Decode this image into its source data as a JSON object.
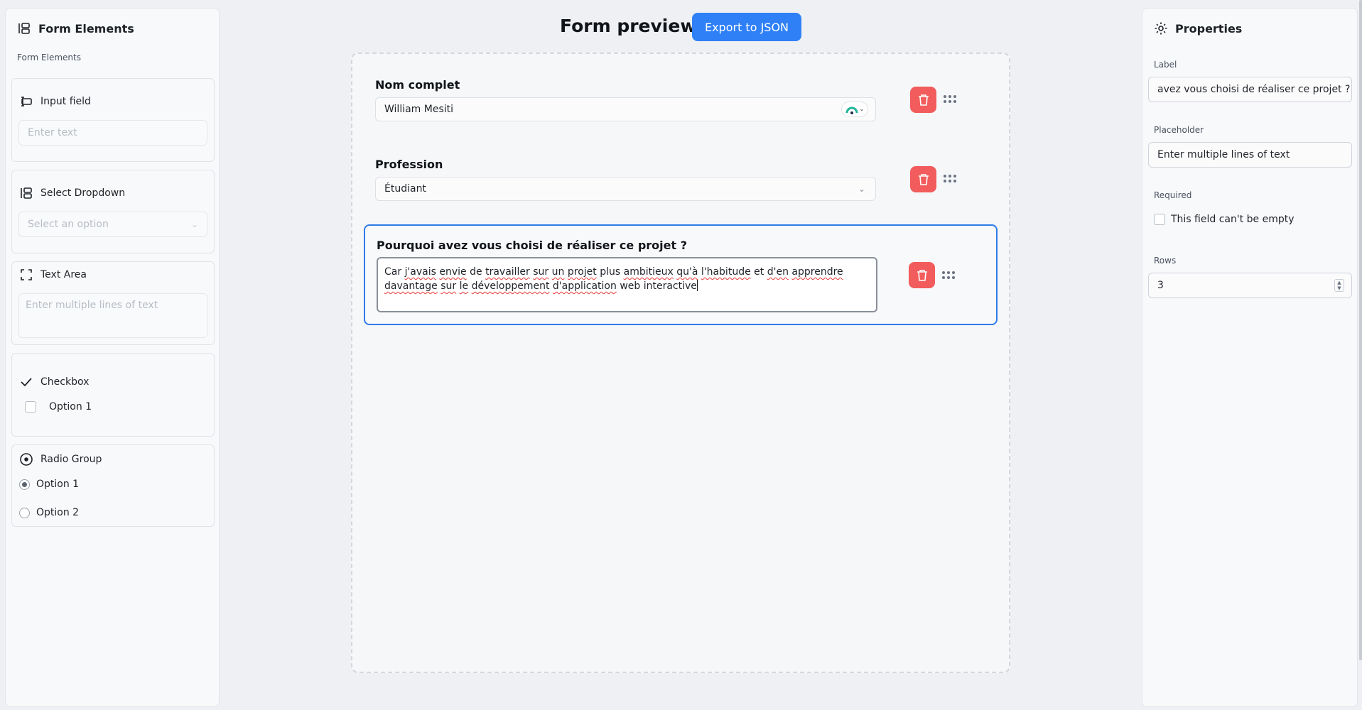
{
  "left_panel": {
    "title": "Form Elements",
    "section_label": "Form Elements",
    "input_field": {
      "title": "Input field",
      "placeholder": "Enter text"
    },
    "select_dropdown": {
      "title": "Select Dropdown",
      "placeholder": "Select an option"
    },
    "text_area": {
      "title": "Text Area",
      "placeholder": "Enter multiple lines of text"
    },
    "checkbox": {
      "title": "Checkbox",
      "option": "Option 1"
    },
    "radio_group": {
      "title": "Radio Group",
      "options": [
        "Option 1",
        "Option 2"
      ],
      "selected": "Option 1"
    }
  },
  "header": {
    "title": "Form preview",
    "export_label": "Export to JSON"
  },
  "form": {
    "fields": [
      {
        "label": "Nom complet",
        "type": "input",
        "value": "William Mesiti"
      },
      {
        "label": "Profession",
        "type": "select",
        "value": "Étudiant"
      },
      {
        "label": "Pourquoi avez vous choisi de réaliser ce projet ?",
        "type": "textarea",
        "value_line1_parts": [
          "Car ",
          "j'avais",
          " ",
          "envie",
          " de ",
          "travailler",
          " ",
          "sur",
          " ",
          "un",
          " ",
          "projet",
          " plus ",
          "ambitieux",
          " ",
          "qu'à",
          " ",
          "l'habitude",
          " et ",
          "d'en",
          " ",
          "apprendre"
        ],
        "value_line2_parts": [
          "davantage",
          " ",
          "sur",
          " ",
          "le",
          " ",
          "développement",
          " ",
          "d'application",
          " web interactive"
        ],
        "selected": true
      }
    ]
  },
  "properties": {
    "title": "Properties",
    "label_label": "Label",
    "label_value": "avez vous choisi de réaliser ce projet ?",
    "placeholder_label": "Placeholder",
    "placeholder_value": "Enter multiple lines of text",
    "required_label": "Required",
    "required_text": "This field can't be empty",
    "rows_label": "Rows",
    "rows_value": "3"
  },
  "colors": {
    "accent": "#2f80f6",
    "delete": "#f25c5c",
    "selected_border": "#2f7be8"
  }
}
